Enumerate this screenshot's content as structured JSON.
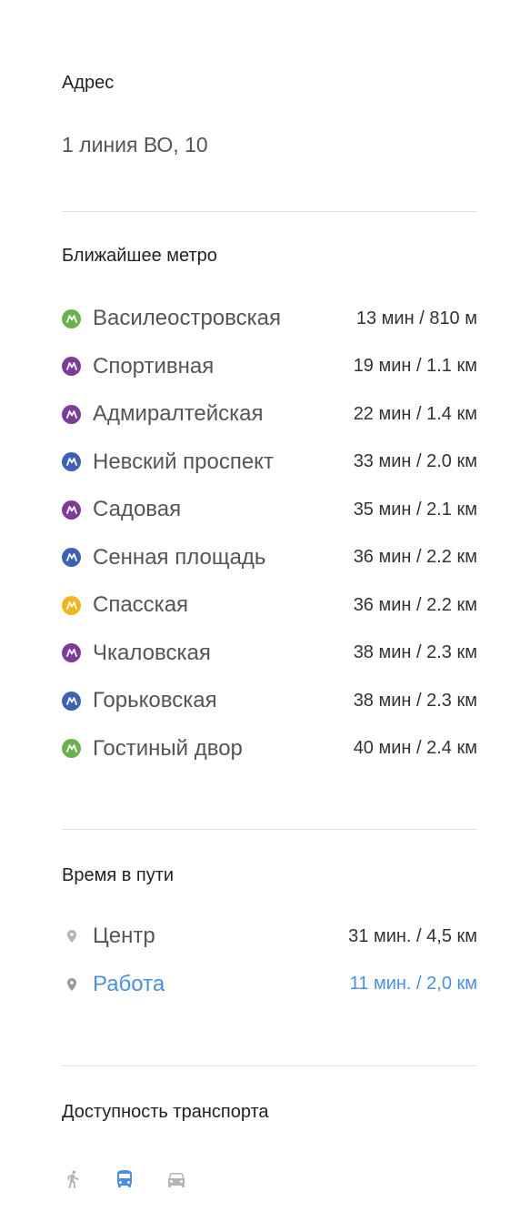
{
  "address": {
    "title": "Адрес",
    "value": "1 линия ВО, 10"
  },
  "metro": {
    "title": "Ближайшее метро",
    "stations": [
      {
        "name": "Василеостровская",
        "time": "13 мин / 810 м",
        "color": "#6ab04c"
      },
      {
        "name": "Спортивная",
        "time": "19 мин / 1.1 км",
        "color": "#7d3c98"
      },
      {
        "name": "Адмиралтейская",
        "time": "22 мин / 1.4 км",
        "color": "#7d3c98"
      },
      {
        "name": "Невский проспект",
        "time": "33 мин / 2.0 км",
        "color": "#3d62b3"
      },
      {
        "name": "Садовая",
        "time": "35 мин / 2.1 км",
        "color": "#7d3c98"
      },
      {
        "name": "Сенная площадь",
        "time": "36 мин / 2.2 км",
        "color": "#3d62b3"
      },
      {
        "name": "Спасская",
        "time": "36 мин / 2.2 км",
        "color": "#efb521"
      },
      {
        "name": "Чкаловская",
        "time": "38 мин / 2.3 км",
        "color": "#7d3c98"
      },
      {
        "name": "Горьковская",
        "time": "38 мин / 2.3 км",
        "color": "#3d62b3"
      },
      {
        "name": "Гостиный двор",
        "time": "40 мин / 2.4 км",
        "color": "#6ab04c"
      }
    ]
  },
  "travel": {
    "title": "Время в пути",
    "places": [
      {
        "name": "Центр",
        "time": "31 мин. / 4,5 км",
        "accent": false
      },
      {
        "name": "Работа",
        "time": "11 мин. / 2,0 км",
        "accent": true
      }
    ]
  },
  "transport": {
    "title": "Доступность транспорта",
    "modes": [
      {
        "icon": "walk-icon",
        "active": false
      },
      {
        "icon": "bus-icon",
        "active": true
      },
      {
        "icon": "car-icon",
        "active": false
      }
    ],
    "active_color": "#4a90e2",
    "inactive_color": "#b5b5b5"
  }
}
